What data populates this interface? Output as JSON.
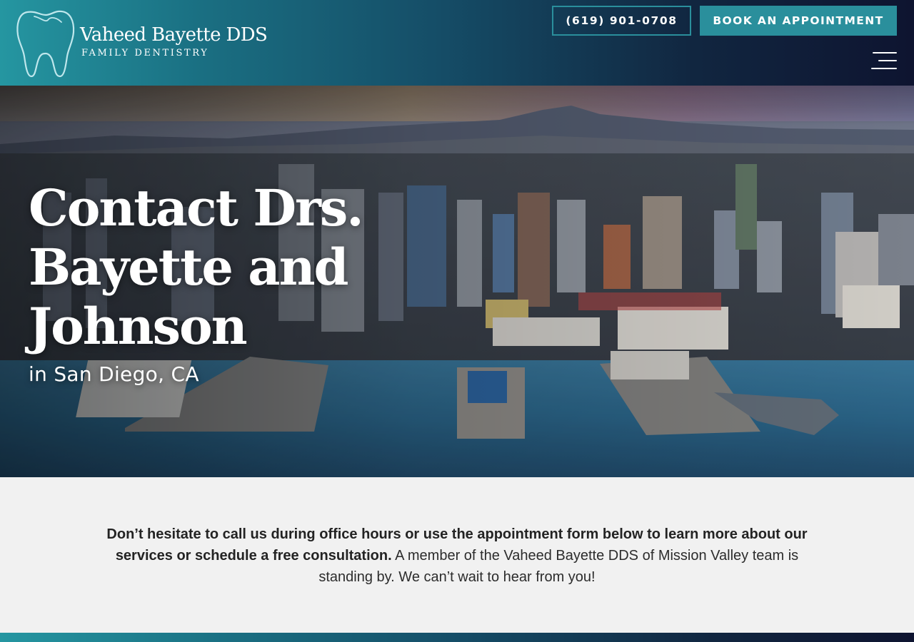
{
  "header": {
    "logo": {
      "name": "Vaheed Bayette DDS",
      "subtitle": "FAMILY DENTISTRY"
    },
    "phone_label": "(619) 901-0708",
    "book_label": "BOOK AN APPOINTMENT",
    "menu_icon": "hamburger-menu-icon",
    "tooth_icon": "tooth-logo-icon"
  },
  "hero": {
    "title": "Contact Drs. Bayette and Johnson",
    "subtitle": "in San Diego, CA"
  },
  "intro": {
    "bold_text": "Don’t hesitate to call us during office hours or use the appointment form below to learn more about our services or schedule a free consultation.",
    "normal_text": " A member of the Vaheed Bayette DDS of Mission Valley team is standing by. We can’t wait to hear from you!"
  },
  "colors": {
    "accent": "#2a8f9c",
    "header_start": "#2596a1",
    "header_end": "#0e1430",
    "background": "#f1f1f1",
    "text": "#2c2c2c"
  }
}
